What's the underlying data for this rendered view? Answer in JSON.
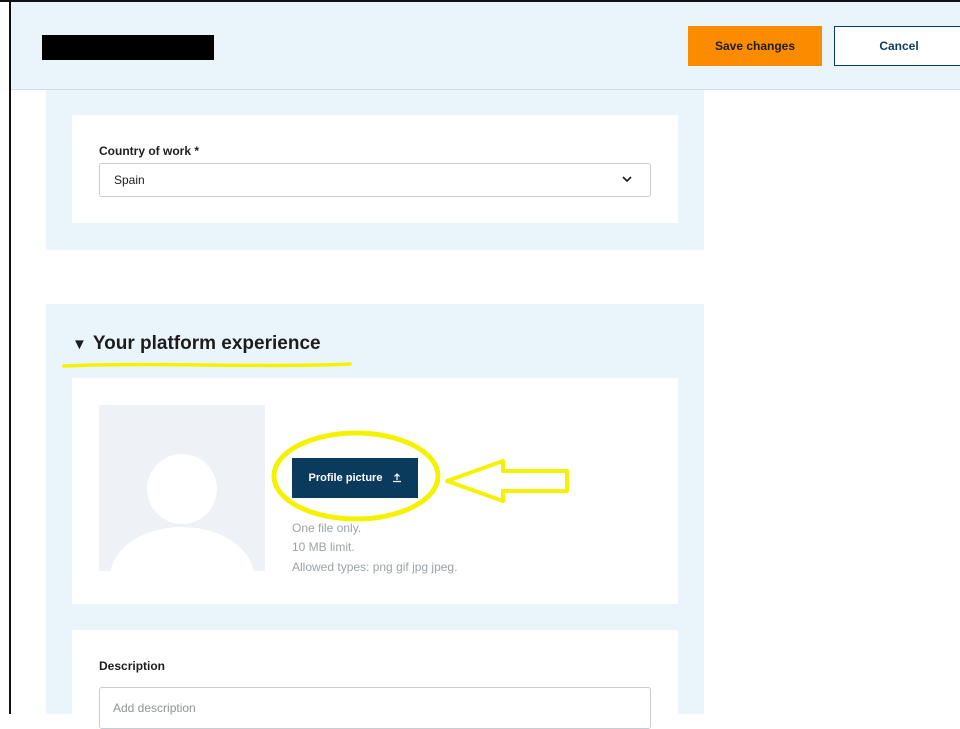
{
  "header": {
    "save_label": "Save changes",
    "cancel_label": "Cancel"
  },
  "country": {
    "label": "Country of work *",
    "value": "Spain"
  },
  "platform": {
    "title": "Your platform experience",
    "toggle_icon": "▼",
    "profile_button_label": "Profile picture",
    "hints": [
      "One file only.",
      "10 MB limit.",
      "Allowed types: png gif jpg jpeg."
    ]
  },
  "description": {
    "label": "Description",
    "placeholder": "Add description"
  },
  "colors": {
    "accent": "#fb8c00",
    "primary": "#0b3b5c",
    "panel_bg": "#eaf5fb",
    "annotation": "#f5f200"
  },
  "icons": {
    "select": "chevron-down-icon",
    "upload": "upload-icon",
    "section_toggle": "triangle-down-icon",
    "avatar": "user-silhouette-icon"
  }
}
